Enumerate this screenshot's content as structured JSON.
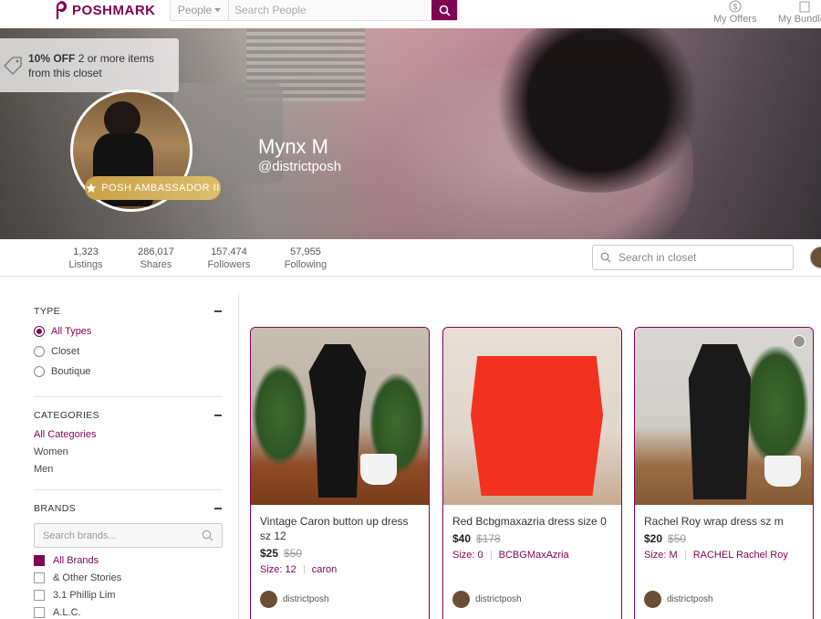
{
  "header": {
    "logo_text": "POSHMARK",
    "search_category": "People",
    "search_placeholder": "Search People",
    "nav": [
      {
        "label": "My Offers",
        "icon": "offers-icon"
      },
      {
        "label": "My Bundles",
        "icon": "bundle-icon"
      }
    ]
  },
  "banner": {
    "promo_bold": "10% OFF",
    "promo_rest": " 2 or more items",
    "promo_line2": "from this closet",
    "badge": "POSH AMBASSADOR II",
    "name": "Mynx M",
    "handle": "@districtposh"
  },
  "stats": [
    {
      "value": "1,323",
      "label": "Listings"
    },
    {
      "value": "286,017",
      "label": "Shares"
    },
    {
      "value": "157,474",
      "label": "Followers"
    },
    {
      "value": "57,955",
      "label": "Following"
    }
  ],
  "closet_search_placeholder": "Search in closet",
  "sidebar": {
    "type_heading": "TYPE",
    "types": [
      "All Types",
      "Closet",
      "Boutique"
    ],
    "categories_heading": "CATEGORIES",
    "categories": [
      "All Categories",
      "Women",
      "Men"
    ],
    "brands_heading": "BRANDS",
    "brand_search_placeholder": "Search brands...",
    "brands": [
      "All Brands",
      "& Other Stories",
      "3.1 Phillip Lim",
      "A.L.C."
    ]
  },
  "listings": [
    {
      "title": "Vintage Caron button up dress sz 12",
      "price": "$25",
      "original": "$50",
      "size": "Size: 12",
      "brand": "caron",
      "seller": "districtposh"
    },
    {
      "title": "Red Bcbgmaxazria dress size 0",
      "price": "$40",
      "original": "$178",
      "size": "Size: 0",
      "brand": "BCBGMaxAzria",
      "seller": "districtposh"
    },
    {
      "title": "Rachel Roy wrap dress sz m",
      "price": "$20",
      "original": "$50",
      "size": "Size: M",
      "brand": "RACHEL Rachel Roy",
      "seller": "districtposh"
    }
  ],
  "colors": {
    "brand": "#7f0353",
    "ambassador_gold": "#d4b15e"
  }
}
